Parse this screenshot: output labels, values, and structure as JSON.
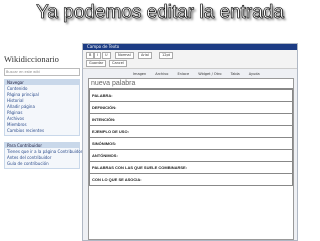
{
  "slide": {
    "title": "Ya podemos editar la entrada"
  },
  "sidebar": {
    "site_name": "Wikidiccionario",
    "search_placeholder": "Buscar en este wiki",
    "nav_header": "Navegar",
    "nav_items": [
      "Contenido",
      "Página principal",
      "Historial",
      "Añadir página",
      "Páginas",
      "Archivos",
      "Miembros",
      "Cambios recientes"
    ],
    "contrib_header": "Para Contribuidor",
    "contrib_items": [
      "Tienes que ir a la página Contribuidor",
      "Antes del contribuidor",
      "Guía de contribución"
    ]
  },
  "editor": {
    "window_title": "Campo de Texto",
    "toolbar": {
      "save_label": "Guardar",
      "cancel_label": "Cancel",
      "font_label": "Normal",
      "style_label": "Arial",
      "size_label": "12pt",
      "tabs": [
        "Imagen",
        "Archivo",
        "Enlace",
        "Widget / Otro",
        "Tabla",
        "Ayuda"
      ]
    },
    "document": {
      "page_title": "nueva palabra",
      "fields": [
        "PALABRA:",
        "DEFINICIÓN:",
        "INTENCIÓN:",
        "EJEMPLO DE USO:",
        "SINÓNIMOS:",
        "ANTÓNIMOS:",
        "PALABRAS CON LAS QUE SUELE COMBINARSE:",
        "CON LO QUE SE ASOCIA:"
      ]
    }
  }
}
